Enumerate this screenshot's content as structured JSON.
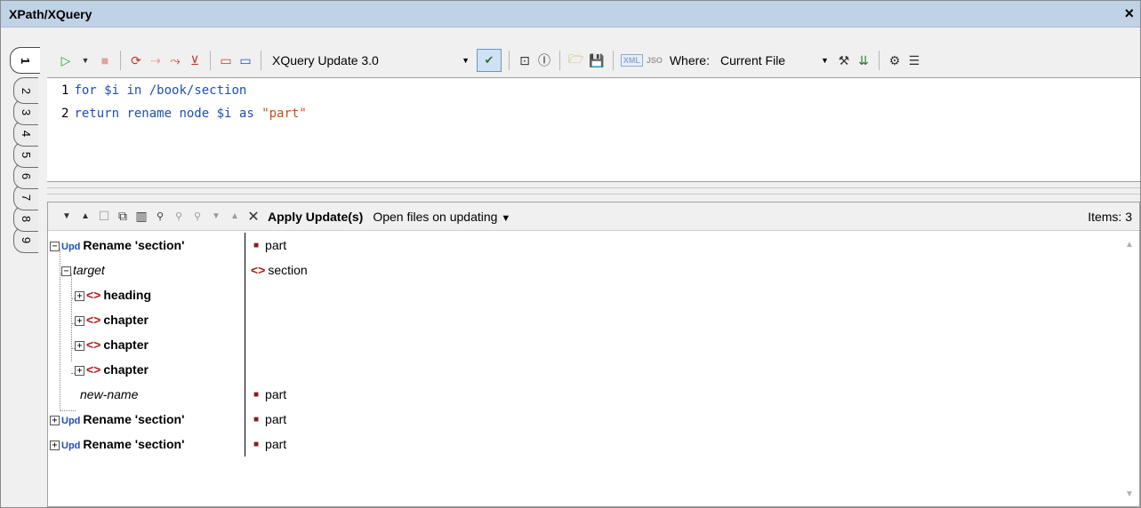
{
  "window": {
    "title": "XPath/XQuery",
    "close_glyph": "×"
  },
  "vtabs": [
    "1",
    "2",
    "3",
    "4",
    "5",
    "6",
    "7",
    "8",
    "9"
  ],
  "toolbar": {
    "language_select": "XQuery Update 3.0",
    "where_label": "Where:",
    "where_value": "Current File",
    "xml_badge": "XML",
    "json_badge": "JSO"
  },
  "editor": {
    "lines": [
      {
        "num": "1",
        "kw1": "for",
        "var": " $i",
        "kw2": " in",
        "rest": " /book/section"
      },
      {
        "num": "2",
        "kw1": "return",
        "rest2": " rename node",
        "var": " $i",
        "kw2": " as",
        "str": " \"part\""
      }
    ]
  },
  "results": {
    "apply_label": "Apply Update(s)",
    "open_files_label": "Open files on updating",
    "items_label": "Items: 3",
    "upd_badge": "Upd",
    "rows": [
      {
        "label": "Rename 'section'",
        "value": "part"
      },
      {
        "label": "target",
        "value": "section"
      },
      {
        "label": "heading"
      },
      {
        "label": "chapter"
      },
      {
        "label": "chapter"
      },
      {
        "label": "chapter"
      },
      {
        "label": "new-name",
        "value": "part"
      },
      {
        "label": "Rename 'section'",
        "value": "part"
      },
      {
        "label": "Rename 'section'",
        "value": "part"
      }
    ]
  },
  "icons": {
    "element": "<>",
    "bullet": "■",
    "plus": "+",
    "minus": "−"
  },
  "colors": {
    "titlebar": "#c0d2e6",
    "keyword": "#1f4fb8",
    "string": "#c2501a",
    "element_icon": "#b01a1a"
  }
}
